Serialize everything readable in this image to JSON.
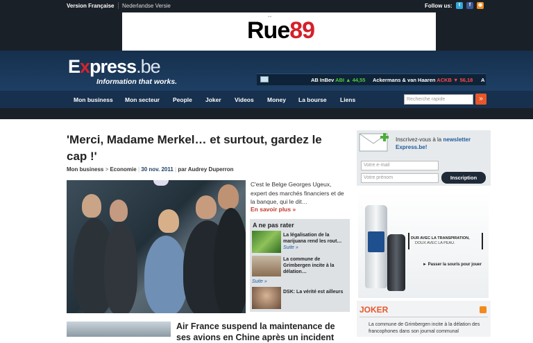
{
  "topbar": {
    "lang_fr": "Version Française",
    "lang_nl": "Nederlandse Versie",
    "follow": "Follow us:",
    "social": [
      "twitter-icon",
      "facebook-icon",
      "rss-icon"
    ]
  },
  "ad_banner": {
    "brand_a": "Rue",
    "brand_b": "89"
  },
  "header": {
    "logo_e": "E",
    "logo_x": "x",
    "logo_rest": "press",
    "logo_be": ".be",
    "tagline": "Information that works."
  },
  "ticker": {
    "item1_name": "AB InBev",
    "item1_code": "ABI",
    "item1_value": "44,55",
    "item2_name": "Ackermans & van Haaren",
    "item2_code": "ACKB",
    "item2_value": "56,18",
    "item3": "A"
  },
  "nav": {
    "items": [
      "Mon business",
      "Mon secteur",
      "People",
      "Joker",
      "Videos",
      "Money",
      "La bourse",
      "Liens"
    ],
    "search_placeholder": "Recherche rapide"
  },
  "article": {
    "title": "'Merci, Madame Merkel… et surtout, gardez le cap !'",
    "category1": "Mon business",
    "category2": "Economie",
    "date": "30 nov. 2011",
    "by": "par",
    "author": "Audrey Duperron",
    "intro": "C'est le Belge Georges Ugeux, expert des marchés financiers et de la banque, qui le dit…",
    "more": "En savoir plus"
  },
  "ne_pas_rater": {
    "title": "A ne pas rater",
    "items": [
      {
        "text": "La légalisation de la marijuana rend les rout…",
        "more": "Suite"
      },
      {
        "text": "La commune de Grimbergen incite à la délation…",
        "more": "Suite"
      },
      {
        "text": "DSK: La vérité est ailleurs"
      }
    ]
  },
  "second_article": {
    "title": "Air France suspend la maintenance de ses avions en Chine après un incident"
  },
  "newsletter": {
    "text": "Inscrivez-vous à la",
    "strong": "newsletter Express.be!",
    "email_placeholder": "Votre e-mail",
    "name_placeholder": "Votre prénom",
    "button": "Inscription"
  },
  "ad_dove": {
    "slogan1": "DUR AVEC LA TRANSPIRATION,",
    "slogan2": "DOUX AVEC LA PEAU.",
    "mouse": "Passer la souris pour jouer"
  },
  "joker": {
    "title": "JOKER",
    "text": "La commune de Grimbergen incite à la délation des francophones dans son journal communal"
  }
}
